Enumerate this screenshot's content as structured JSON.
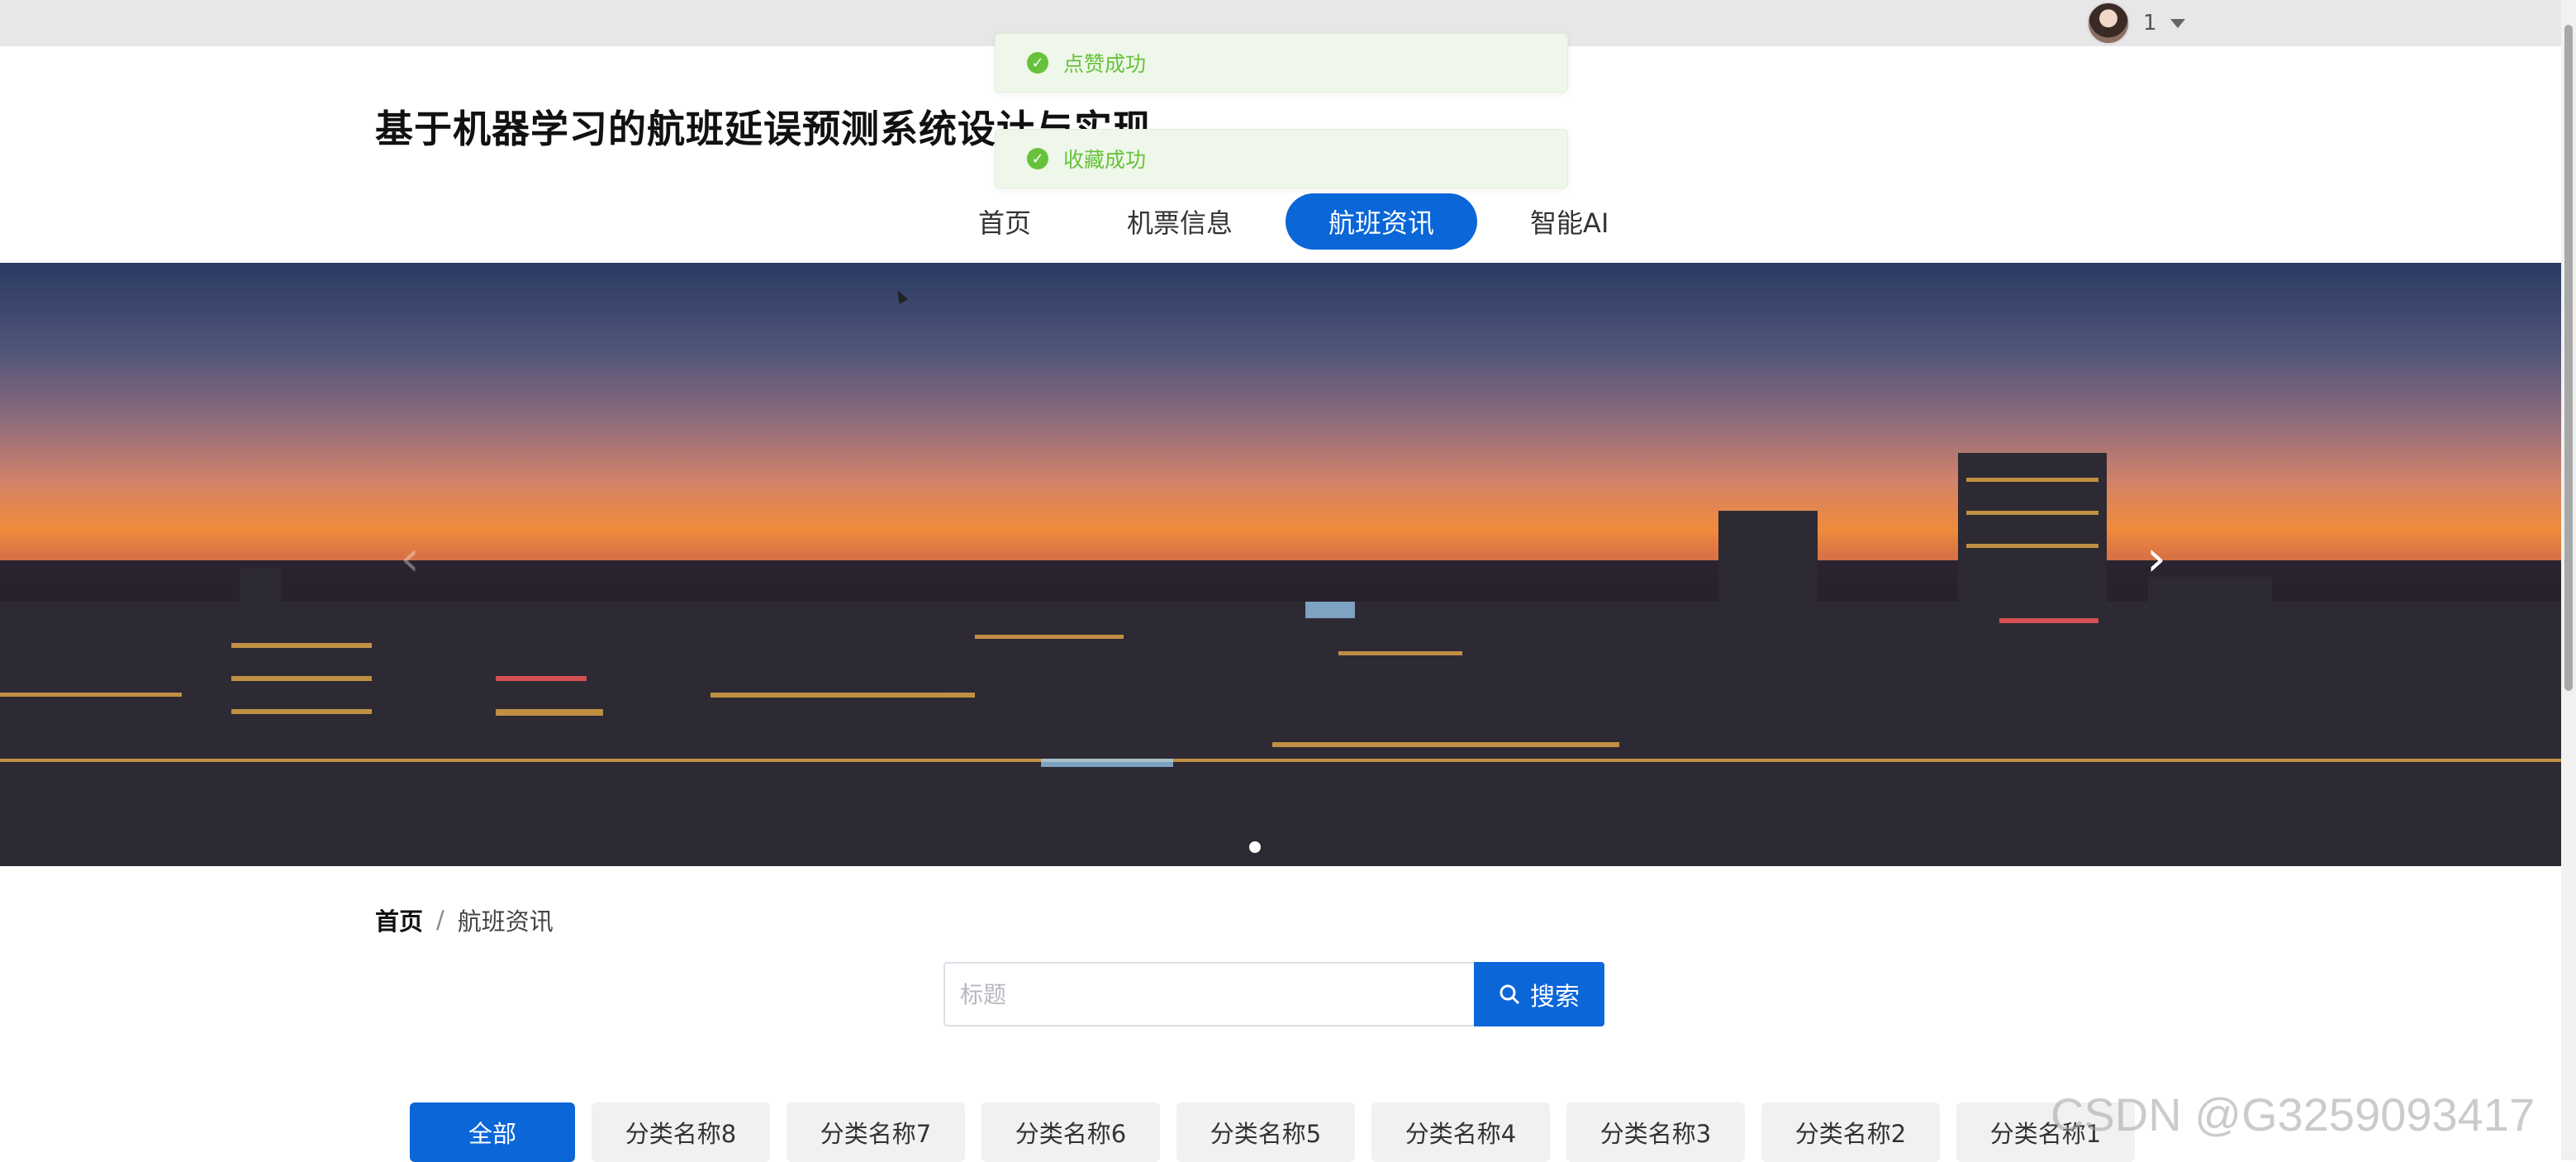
{
  "user": {
    "name": "1"
  },
  "site": {
    "title": "基于机器学习的航班延误预测系统设计与实现"
  },
  "nav": {
    "items": [
      {
        "label": "首页"
      },
      {
        "label": "机票信息"
      },
      {
        "label": "航班资讯"
      },
      {
        "label": "智能AI"
      }
    ],
    "active": "航班资讯"
  },
  "toasts": [
    {
      "text": "点赞成功",
      "icon": "check-circle-icon"
    },
    {
      "text": "收藏成功",
      "icon": "check-circle-icon"
    }
  ],
  "carousel": {
    "slide_count": 1,
    "active_index": 0
  },
  "breadcrumb": {
    "home": "首页",
    "separator": "/",
    "current": "航班资讯"
  },
  "search": {
    "placeholder": "标题",
    "value": "",
    "button_label": "搜索"
  },
  "categories": {
    "items": [
      "全部",
      "分类名称8",
      "分类名称7",
      "分类名称6",
      "分类名称5",
      "分类名称4",
      "分类名称3",
      "分类名称2",
      "分类名称1"
    ],
    "active": "全部"
  },
  "watermark": "CSDN @G3259093417",
  "colors": {
    "primary": "#0b66d8",
    "success": "#67c23a"
  }
}
